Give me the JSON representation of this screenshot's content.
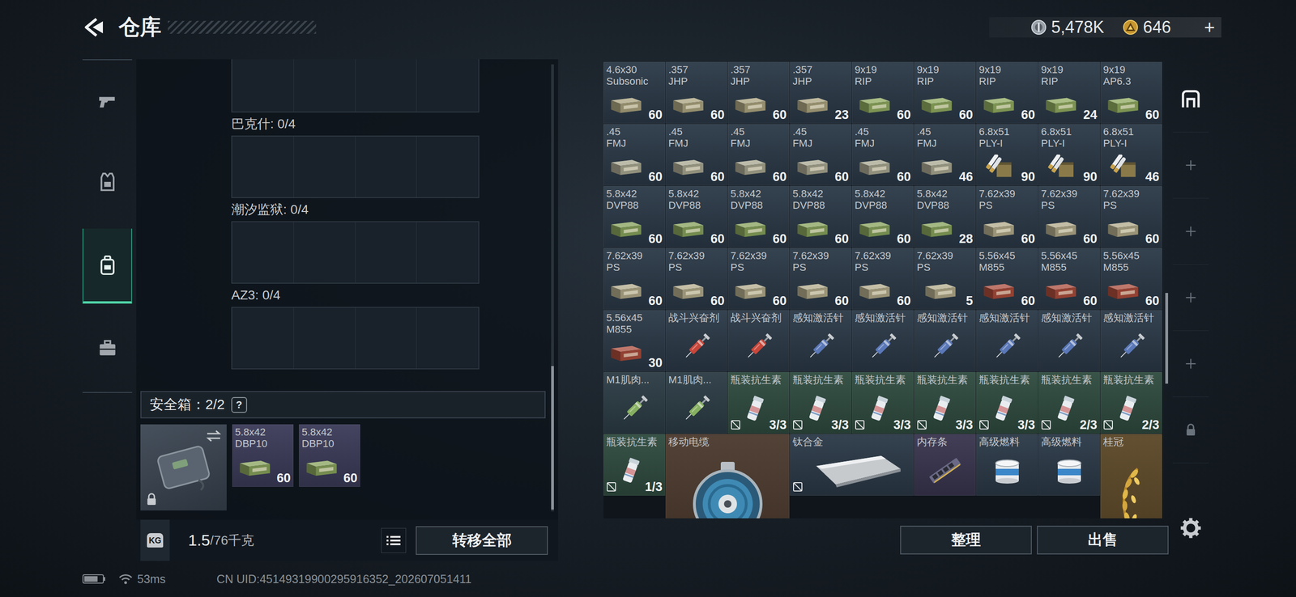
{
  "header": {
    "title": "仓库",
    "currency": [
      {
        "kind": "silver",
        "value": "5,478K"
      },
      {
        "kind": "gold",
        "value": "646"
      }
    ],
    "add": "+"
  },
  "nav": [
    {
      "kind": "weapon",
      "selected": false
    },
    {
      "kind": "armor",
      "selected": false
    },
    {
      "kind": "backpack",
      "selected": true
    },
    {
      "kind": "tools",
      "selected": false
    }
  ],
  "top_slot": {
    "cells": 4
  },
  "containers": [
    {
      "label": "巴克什: 0/4",
      "cells": 4
    },
    {
      "label": "潮汐监狱: 0/4",
      "cells": 4
    },
    {
      "label": "AZ3: 0/4",
      "cells": 4
    }
  ],
  "safe_box": {
    "label": "安全箱：2/2",
    "help": "?",
    "locked": true,
    "items": [
      {
        "kind": "ammo",
        "caliber": "5.8x42",
        "type": "DBP10",
        "count": "60",
        "box": "#86a05a",
        "color": "#3a3a58",
        "marked": false
      },
      {
        "kind": "ammo",
        "caliber": "5.8x42",
        "type": "DBP10",
        "count": "60",
        "box": "#86a05a",
        "color": "#3a3a58",
        "marked": false
      }
    ]
  },
  "weight": {
    "icon": "KG",
    "current": "1.5",
    "max": "/76千克"
  },
  "transfer_button": "转移全部",
  "stash": {
    "items": [
      {
        "kind": "ammo",
        "caliber": "4.6x30",
        "type": "Subsonic",
        "count": "60",
        "box": "#a8a07c",
        "color": "#2a3846",
        "marked": false
      },
      {
        "kind": "ammo",
        "caliber": ".357",
        "type": "JHP",
        "count": "60",
        "box": "#aaa27e",
        "color": "#2a3846",
        "marked": false
      },
      {
        "kind": "ammo",
        "caliber": ".357",
        "type": "JHP",
        "count": "60",
        "box": "#aaa27e",
        "color": "#2a3846",
        "marked": false
      },
      {
        "kind": "ammo",
        "caliber": ".357",
        "type": "JHP",
        "count": "23",
        "box": "#aaa27e",
        "color": "#2a3846",
        "marked": false
      },
      {
        "kind": "ammo",
        "caliber": "9x19",
        "type": "RIP",
        "count": "60",
        "box": "#8ea85e",
        "color": "#2a3846",
        "marked": false
      },
      {
        "kind": "ammo",
        "caliber": "9x19",
        "type": "RIP",
        "count": "60",
        "box": "#8ea85e",
        "color": "#2a3846",
        "marked": false
      },
      {
        "kind": "ammo",
        "caliber": "9x19",
        "type": "RIP",
        "count": "60",
        "box": "#8ea85e",
        "color": "#2a3846",
        "marked": false
      },
      {
        "kind": "ammo",
        "caliber": "9x19",
        "type": "RIP",
        "count": "24",
        "box": "#8ea85e",
        "color": "#2a3846",
        "marked": false
      },
      {
        "kind": "ammo",
        "caliber": "9x19",
        "type": "AP6.3",
        "count": "60",
        "box": "#8ea85e",
        "color": "#2a3846",
        "marked": false
      },
      {
        "kind": "ammo",
        "caliber": ".45",
        "type": "FMJ",
        "count": "60",
        "box": "#a6a48e",
        "color": "#2a3846",
        "marked": false
      },
      {
        "kind": "ammo",
        "caliber": ".45",
        "type": "FMJ",
        "count": "60",
        "box": "#a6a48e",
        "color": "#2a3846",
        "marked": false
      },
      {
        "kind": "ammo",
        "caliber": ".45",
        "type": "FMJ",
        "count": "60",
        "box": "#a6a48e",
        "color": "#2a3846",
        "marked": false
      },
      {
        "kind": "ammo",
        "caliber": ".45",
        "type": "FMJ",
        "count": "60",
        "box": "#a6a48e",
        "color": "#2a3846",
        "marked": false
      },
      {
        "kind": "ammo",
        "caliber": ".45",
        "type": "FMJ",
        "count": "60",
        "box": "#a6a48e",
        "color": "#2a3846",
        "marked": false
      },
      {
        "kind": "ammo",
        "caliber": ".45",
        "type": "FMJ",
        "count": "46",
        "box": "#a6a48e",
        "color": "#2a3846",
        "marked": false
      },
      {
        "kind": "rounds",
        "caliber": "6.8x51",
        "type": "PLY-I",
        "count": "90",
        "box": "#8a7a4a",
        "color": "#2a3846",
        "marked": false
      },
      {
        "kind": "rounds",
        "caliber": "6.8x51",
        "type": "PLY-I",
        "count": "90",
        "box": "#8a7a4a",
        "color": "#2a3846",
        "marked": false
      },
      {
        "kind": "rounds",
        "caliber": "6.8x51",
        "type": "PLY-I",
        "count": "46",
        "box": "#8a7a4a",
        "color": "#2a3846",
        "marked": false
      },
      {
        "kind": "ammo",
        "caliber": "5.8x42",
        "type": "DVP88",
        "count": "60",
        "box": "#86a05a",
        "color": "#2a3846",
        "marked": false
      },
      {
        "kind": "ammo",
        "caliber": "5.8x42",
        "type": "DVP88",
        "count": "60",
        "box": "#86a05a",
        "color": "#2a3846",
        "marked": false
      },
      {
        "kind": "ammo",
        "caliber": "5.8x42",
        "type": "DVP88",
        "count": "60",
        "box": "#86a05a",
        "color": "#2a3846",
        "marked": false
      },
      {
        "kind": "ammo",
        "caliber": "5.8x42",
        "type": "DVP88",
        "count": "60",
        "box": "#86a05a",
        "color": "#2a3846",
        "marked": false
      },
      {
        "kind": "ammo",
        "caliber": "5.8x42",
        "type": "DVP88",
        "count": "60",
        "box": "#86a05a",
        "color": "#2a3846",
        "marked": false
      },
      {
        "kind": "ammo",
        "caliber": "5.8x42",
        "type": "DVP88",
        "count": "28",
        "box": "#86a05a",
        "color": "#2a3846",
        "marked": false
      },
      {
        "kind": "ammo",
        "caliber": "7.62x39",
        "type": "PS",
        "count": "60",
        "box": "#b0a888",
        "color": "#2a3846",
        "marked": false
      },
      {
        "kind": "ammo",
        "caliber": "7.62x39",
        "type": "PS",
        "count": "60",
        "box": "#b0a888",
        "color": "#2a3846",
        "marked": false
      },
      {
        "kind": "ammo",
        "caliber": "7.62x39",
        "type": "PS",
        "count": "60",
        "box": "#b0a888",
        "color": "#2a3846",
        "marked": false
      },
      {
        "kind": "ammo",
        "caliber": "7.62x39",
        "type": "PS",
        "count": "60",
        "box": "#b0a888",
        "color": "#2a3846",
        "marked": false
      },
      {
        "kind": "ammo",
        "caliber": "7.62x39",
        "type": "PS",
        "count": "60",
        "box": "#b0a888",
        "color": "#2a3846",
        "marked": false
      },
      {
        "kind": "ammo",
        "caliber": "7.62x39",
        "type": "PS",
        "count": "60",
        "box": "#b0a888",
        "color": "#2a3846",
        "marked": false
      },
      {
        "kind": "ammo",
        "caliber": "7.62x39",
        "type": "PS",
        "count": "60",
        "box": "#b0a888",
        "color": "#2a3846",
        "marked": false
      },
      {
        "kind": "ammo",
        "caliber": "7.62x39",
        "type": "PS",
        "count": "60",
        "box": "#b0a888",
        "color": "#2a3846",
        "marked": false
      },
      {
        "kind": "ammo",
        "caliber": "7.62x39",
        "type": "PS",
        "count": "5",
        "box": "#b0a888",
        "color": "#2a3846",
        "marked": false
      },
      {
        "kind": "ammo",
        "caliber": "5.56x45",
        "type": "M855",
        "count": "60",
        "box": "#a84a3a",
        "color": "#2a3846",
        "marked": false
      },
      {
        "kind": "ammo",
        "caliber": "5.56x45",
        "type": "M855",
        "count": "60",
        "box": "#a84a3a",
        "color": "#2a3846",
        "marked": false
      },
      {
        "kind": "ammo",
        "caliber": "5.56x45",
        "type": "M855",
        "count": "60",
        "box": "#a84a3a",
        "color": "#2a3846",
        "marked": false
      },
      {
        "kind": "ammo",
        "caliber": "5.56x45",
        "type": "M855",
        "count": "30",
        "box": "#a84a3a",
        "color": "#2a3846",
        "marked": false
      },
      {
        "kind": "stim",
        "name": "战斗兴奋剂",
        "color": "#2a3846",
        "marked": false
      },
      {
        "kind": "stim",
        "name": "战斗兴奋剂",
        "color": "#2a3846",
        "marked": false
      },
      {
        "kind": "injector",
        "name": "感知激活针",
        "color": "#2a3846",
        "marked": false
      },
      {
        "kind": "injector",
        "name": "感知激活针",
        "color": "#2a3846",
        "marked": false
      },
      {
        "kind": "injector",
        "name": "感知激活针",
        "color": "#2a3846",
        "marked": false
      },
      {
        "kind": "injector",
        "name": "感知激活针",
        "color": "#2a3846",
        "marked": false
      },
      {
        "kind": "injector",
        "name": "感知激活针",
        "color": "#2a3846",
        "marked": false
      },
      {
        "kind": "injector",
        "name": "感知激活针",
        "color": "#2a3846",
        "marked": false
      },
      {
        "kind": "m1",
        "name": "M1肌肉...",
        "color": "#2b3b44",
        "marked": false
      },
      {
        "kind": "m1",
        "name": "M1肌肉...",
        "color": "#2b3b44",
        "marked": false
      },
      {
        "kind": "antibiotic",
        "name": "瓶装抗生素",
        "count": "3/3",
        "color": "#2e4a3e",
        "marked": true
      },
      {
        "kind": "antibiotic",
        "name": "瓶装抗生素",
        "count": "3/3",
        "color": "#2e4a3e",
        "marked": true
      },
      {
        "kind": "antibiotic",
        "name": "瓶装抗生素",
        "count": "3/3",
        "color": "#2e4a3e",
        "marked": true
      },
      {
        "kind": "antibiotic",
        "name": "瓶装抗生素",
        "count": "3/3",
        "color": "#2e4a3e",
        "marked": true
      },
      {
        "kind": "antibiotic",
        "name": "瓶装抗生素",
        "count": "3/3",
        "color": "#2e4a3e",
        "marked": true
      },
      {
        "kind": "antibiotic",
        "name": "瓶装抗生素",
        "count": "2/3",
        "color": "#2e4a3e",
        "marked": true
      },
      {
        "kind": "antibiotic",
        "name": "瓶装抗生素",
        "count": "2/3",
        "color": "#2e4a3e",
        "marked": true
      },
      {
        "kind": "antibiotic",
        "name": "瓶装抗生素",
        "count": "1/3",
        "color": "#2e4a3e",
        "marked": true
      },
      {
        "kind": "cable",
        "name": "移动电缆",
        "color": "#4a382c",
        "marked": false
      },
      {
        "kind": "ingot",
        "name": "钛合金",
        "color": "#2a3846",
        "marked": true
      },
      {
        "kind": "ram",
        "name": "内存条",
        "color": "#38344e",
        "marked": false
      },
      {
        "kind": "fuel",
        "name": "高级燃料",
        "color": "#2a3846",
        "marked": false
      },
      {
        "kind": "fuel",
        "name": "高级燃料",
        "color": "#2a3846",
        "marked": false
      },
      {
        "kind": "crown",
        "name": "桂冠",
        "color": "#5a4626",
        "marked": false
      }
    ]
  },
  "actions": [
    "整理",
    "出售"
  ],
  "side_tabs": [
    {
      "kind": "stash",
      "selected": true
    },
    {
      "kind": "add",
      "selected": false
    },
    {
      "kind": "add",
      "selected": false
    },
    {
      "kind": "add",
      "selected": false
    },
    {
      "kind": "add",
      "selected": false
    },
    {
      "kind": "locked",
      "selected": false
    }
  ],
  "status": {
    "battery": 0.75,
    "ping": "53ms",
    "uid": "CN UID:45149319900295916352_202607051411"
  }
}
